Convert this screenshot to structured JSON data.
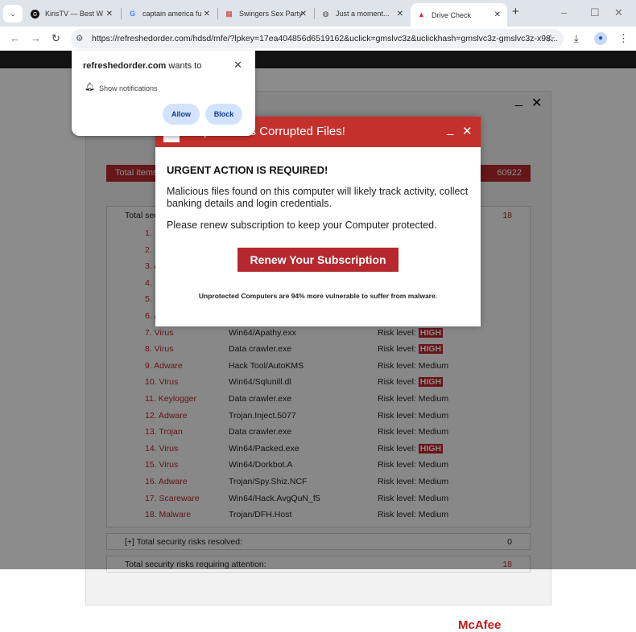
{
  "browser": {
    "tabs": [
      {
        "title": "KirisTV — Best W",
        "icon": "tv-logo-icon"
      },
      {
        "title": "captain america fu",
        "icon": "google-icon"
      },
      {
        "title": "Swingers Sex Party",
        "icon": "site-icon"
      },
      {
        "title": "Just a moment...",
        "icon": "globe-icon"
      },
      {
        "title": "Drive Check",
        "icon": "warning-icon",
        "active": true
      }
    ],
    "url": "https://refreshedorder.com/hdsd/mfe/?lpkey=17ea404856d6519162&uclick=gmslvc3z&uclickhash=gmslvc3z-gmslvc3z-x98..."
  },
  "notification": {
    "title": "refreshedorder.com wants to",
    "permission": "Show notifications",
    "allow": "Allow",
    "block": "Block"
  },
  "page": {
    "total_items_label": "Total items",
    "total_items_value": "60922",
    "total_sec_label": "Total sec",
    "total_sec_value": "18",
    "hidden_rows": [
      "1.",
      "2.",
      "3. A",
      "4.",
      "5.",
      "6. A"
    ],
    "rows": [
      {
        "n": "7. Virus",
        "f": "Win64/Apathy.exx",
        "r": "Risk level:",
        "lvl": "HIGH"
      },
      {
        "n": "8. Virus",
        "f": "Data crawler.exe",
        "r": "Risk level:",
        "lvl": "HIGH"
      },
      {
        "n": "9. Adware",
        "f": "Hack Tool/AutoKMS",
        "r": "Risk level: Medium"
      },
      {
        "n": "10. Virus",
        "f": "Win64/Sqlunill.dl",
        "r": "Risk level:",
        "lvl": "HIGH"
      },
      {
        "n": "11. Keylogger",
        "f": "Data crawler.exe",
        "r": "Risk level: Medium"
      },
      {
        "n": "12. Adware",
        "f": "Trojan.Inject.5077",
        "r": "Risk level: Medium"
      },
      {
        "n": "13. Trojan",
        "f": "Data crawler.exe",
        "r": "Risk level: Medium"
      },
      {
        "n": "14. Virus",
        "f": "Win64/Packed.exe",
        "r": "Risk level:",
        "lvl": "HIGH"
      },
      {
        "n": "15. Virus",
        "f": "Win64/Dorkbot.A",
        "r": "Risk level: Medium"
      },
      {
        "n": "16. Adware",
        "f": "Trojan/Spy.Shiz.NCF",
        "r": "Risk level: Medium"
      },
      {
        "n": "17. Scareware",
        "f": "Win64/Hack.AvgQuN_f5",
        "r": "Risk level: Medium"
      },
      {
        "n": "18. Malware",
        "f": "Trojan/DFH.Host",
        "r": "Risk level: Medium"
      }
    ],
    "resolved_label": "[+] Total security risks resolved:",
    "resolved_value": "0",
    "attention_label": "Total security risks requiring attention:",
    "attention_value": "18",
    "logo": "McAfee"
  },
  "modal": {
    "title": "puter Has Corrupted Files!",
    "urgent": "URGENT ACTION IS REQUIRED!",
    "p1": "Malicious files found on this computer will likely track activity, collect banking details and login credentials.",
    "p2": "Please renew subscription to keep your Computer protected.",
    "button": "Renew Your Subscription",
    "footer": "Unprotected Computers are 94% more vulnerable to suffer from malware."
  }
}
